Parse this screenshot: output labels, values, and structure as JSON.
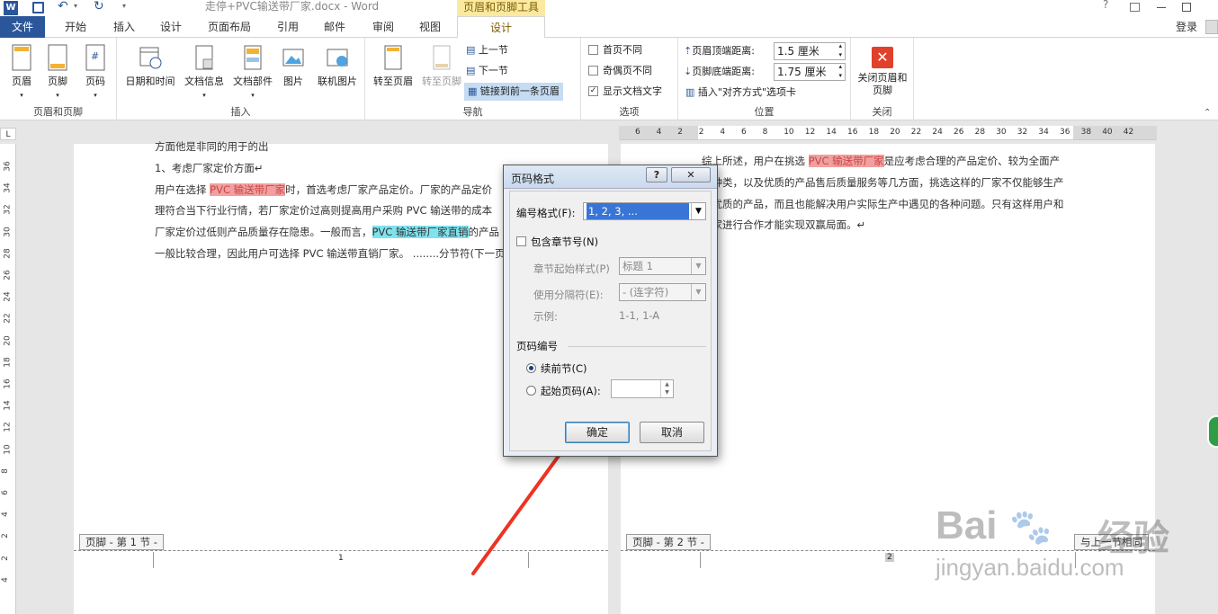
{
  "window": {
    "title": "走停+PVC输送带厂家.docx - Word",
    "context_tab": "页眉和页脚工具",
    "help": "?"
  },
  "tabs": [
    {
      "label": "文件"
    },
    {
      "label": "开始"
    },
    {
      "label": "插入"
    },
    {
      "label": "设计"
    },
    {
      "label": "页面布局"
    },
    {
      "label": "引用"
    },
    {
      "label": "邮件"
    },
    {
      "label": "审阅"
    },
    {
      "label": "视图"
    },
    {
      "label": "设计"
    }
  ],
  "account": {
    "login": "登录"
  },
  "ribbon": {
    "groups": {
      "hf": "页眉和页脚",
      "insert": "插入",
      "nav": "导航",
      "options": "选项",
      "position": "位置",
      "close": "关闭"
    },
    "hf_buttons": [
      "页眉",
      "页脚",
      "页码"
    ],
    "insert_buttons": [
      "日期和时间",
      "文档信息",
      "文档部件",
      "图片",
      "联机图片"
    ],
    "nav_buttons": [
      "转至页眉",
      "转至页脚"
    ],
    "nav_small": [
      "上一节",
      "下一节",
      "链接到前一条页眉"
    ],
    "options": [
      {
        "label": "首页不同",
        "checked": false
      },
      {
        "label": "奇偶页不同",
        "checked": false
      },
      {
        "label": "显示文档文字",
        "checked": true
      }
    ],
    "position": {
      "header_label": "页眉顶端距离:",
      "header_value": "1.5 厘米",
      "footer_label": "页脚底端距离:",
      "footer_value": "1.75 厘米",
      "align_tab": "插入\"对齐方式\"选项卡"
    },
    "close_label": "关闭页眉和页脚"
  },
  "ruler": {
    "corner": "L",
    "ticks": [
      "6",
      "4",
      "2",
      "2",
      "4",
      "6",
      "8",
      "10",
      "12",
      "14",
      "16",
      "18",
      "20",
      "22",
      "24",
      "26",
      "28",
      "30",
      "32",
      "34",
      "36",
      "38",
      "40",
      "42"
    ]
  },
  "vruler": [
    "36",
    "34",
    "32",
    "30",
    "28",
    "26",
    "24",
    "22",
    "20",
    "18",
    "16",
    "14",
    "12",
    "10",
    "8",
    "6",
    "4",
    "2",
    "2",
    "4"
  ],
  "page1": {
    "lines": [
      {
        "parts": [
          {
            "t": "方面他是非同的用于的出",
            "h": ""
          }
        ]
      },
      {
        "parts": [
          {
            "t": "1、考虑厂家定价方面↵",
            "h": ""
          }
        ]
      },
      {
        "parts": [
          {
            "t": "用户在选择 ",
            "h": ""
          },
          {
            "t": "PVC 输送带厂家",
            "h": "red"
          },
          {
            "t": "时，首选考虑厂家产品定价。厂家的产品定价",
            "h": ""
          }
        ]
      },
      {
        "parts": [
          {
            "t": "理符合当下行业行情，若厂家定价过高则提高用户采购 PVC 输送带的成本",
            "h": ""
          }
        ]
      },
      {
        "parts": [
          {
            "t": "厂家定价过低则产品质量存在隐患。一般而言，",
            "h": ""
          },
          {
            "t": "PVC 输送带厂家直销",
            "h": "cyan"
          },
          {
            "t": "的产品",
            "h": ""
          }
        ]
      },
      {
        "parts": [
          {
            "t": "一般比较合理，因此用户可选择 PVC 输送带直销厂家。 ........分节符(下一页",
            "h": ""
          }
        ]
      }
    ],
    "footer_label": "页脚 - 第 1 节 -",
    "page_num": "1"
  },
  "page2": {
    "lines": [
      {
        "parts": [
          {
            "t": "综上所述，用户在挑选 ",
            "h": ""
          },
          {
            "t": "PVC 输送带厂家",
            "h": "red"
          },
          {
            "t": "是应考虑合理的产品定价、较为全面产",
            "h": ""
          }
        ]
      },
      {
        "parts": [
          {
            "t": "品种类，以及优质的产品售后质量服务等几方面，挑选这样的厂家不仅能够生产",
            "h": ""
          }
        ]
      },
      {
        "parts": [
          {
            "t": "出优质的产品，而且也能解决用户实际生产中遇见的各种问题。只有这样用户和",
            "h": ""
          }
        ]
      },
      {
        "parts": [
          {
            "t": "厂家进行合作才能实现双赢局面。↵",
            "h": ""
          }
        ]
      }
    ],
    "footer_label": "页脚 - 第 2 节 -",
    "same_prev": "与上一节相同",
    "page_num": "2"
  },
  "dialog": {
    "title": "页码格式",
    "format_label": "编号格式(F):",
    "format_value": "1, 2, 3, ...",
    "include_chapter": "包含章节号(N)",
    "chapter_style_label": "章节起始样式(P)",
    "chapter_style_value": "标题 1",
    "separator_label": "使用分隔符(E):",
    "separator_value": "-  (连字符)",
    "example_label": "示例:",
    "example_value": "1-1, 1-A",
    "numbering_title": "页码编号",
    "continue_label": "续前节(C)",
    "start_label": "起始页码(A):",
    "ok": "确定",
    "cancel": "取消"
  },
  "watermark": {
    "brand": "Bai",
    "brand2": "经验",
    "url": "jingyan.baidu.com"
  },
  "colors": {
    "accent": "#2b579a",
    "arrow": "#ee3322",
    "close_red": "#e0412c"
  }
}
